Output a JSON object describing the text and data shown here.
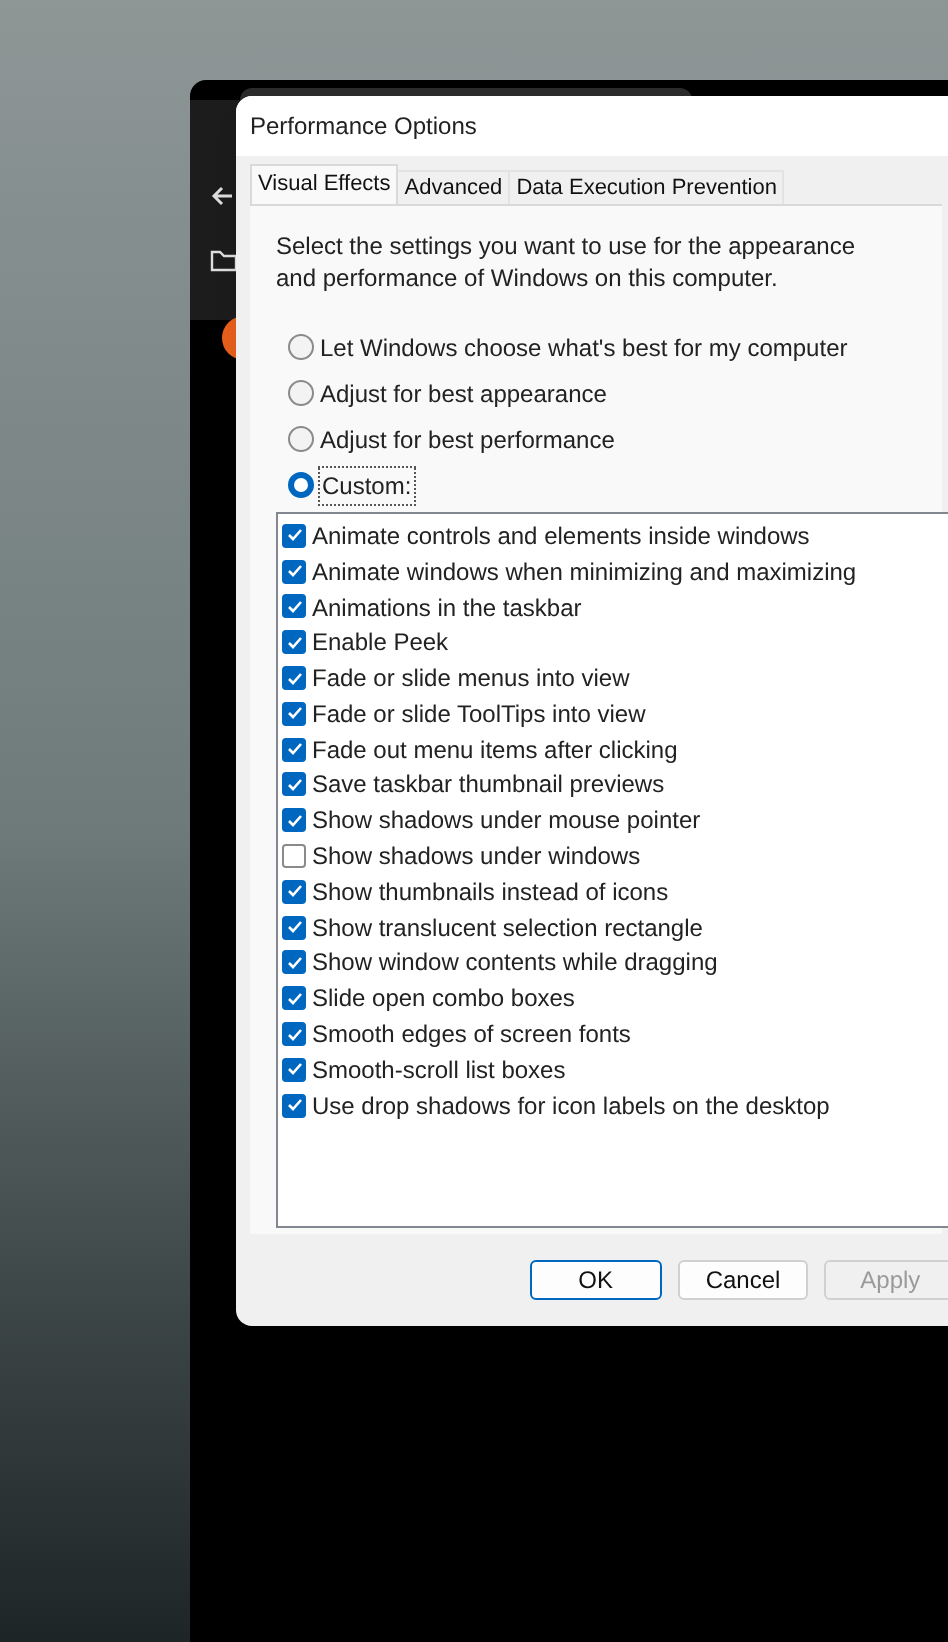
{
  "dialog": {
    "title": "Performance Options",
    "tabs": [
      {
        "label": "Visual Effects",
        "selected": true
      },
      {
        "label": "Advanced",
        "selected": false
      },
      {
        "label": "Data Execution Prevention",
        "selected": false
      }
    ],
    "description": "Select the settings you want to use for the appearance and performance of Windows on this computer.",
    "options": [
      {
        "label": "Let Windows choose what's best for my computer",
        "selected": false
      },
      {
        "label": "Adjust for best appearance",
        "selected": false
      },
      {
        "label": "Adjust for best performance",
        "selected": false
      },
      {
        "label": "Custom:",
        "selected": true
      }
    ],
    "effects": [
      {
        "label": "Animate controls and elements inside windows",
        "checked": true
      },
      {
        "label": "Animate windows when minimizing and maximizing",
        "checked": true
      },
      {
        "label": "Animations in the taskbar",
        "checked": true
      },
      {
        "label": "Enable Peek",
        "checked": true
      },
      {
        "label": "Fade or slide menus into view",
        "checked": true
      },
      {
        "label": "Fade or slide ToolTips into view",
        "checked": true
      },
      {
        "label": "Fade out menu items after clicking",
        "checked": true
      },
      {
        "label": "Save taskbar thumbnail previews",
        "checked": true
      },
      {
        "label": "Show shadows under mouse pointer",
        "checked": true
      },
      {
        "label": "Show shadows under windows",
        "checked": false
      },
      {
        "label": "Show thumbnails instead of icons",
        "checked": true
      },
      {
        "label": "Show translucent selection rectangle",
        "checked": true
      },
      {
        "label": "Show window contents while dragging",
        "checked": true
      },
      {
        "label": "Slide open combo boxes",
        "checked": true
      },
      {
        "label": "Smooth edges of screen fonts",
        "checked": true
      },
      {
        "label": "Smooth-scroll list boxes",
        "checked": true
      },
      {
        "label": "Use drop shadows for icon labels on the desktop",
        "checked": true
      }
    ],
    "buttons": [
      {
        "label": "OK",
        "kind": "default",
        "disabled": false
      },
      {
        "label": "Cancel",
        "kind": "normal",
        "disabled": false
      },
      {
        "label": "Apply",
        "kind": "normal",
        "disabled": true
      }
    ]
  }
}
